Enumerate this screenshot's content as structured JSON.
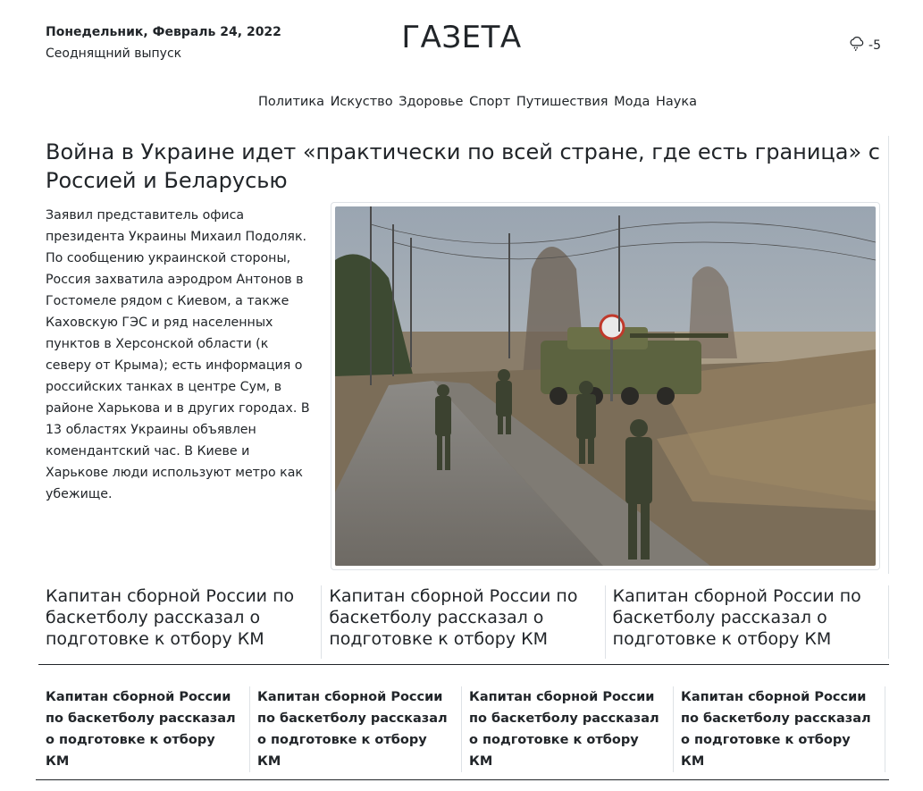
{
  "header": {
    "date": "Понедельник, Февраль 24, 2022",
    "issue": "Сеоднящний выпуск",
    "title": "ГАЗЕТА",
    "weather_value": "-5",
    "weather_icon": "cloud-drizzle-icon"
  },
  "nav": {
    "items": [
      "Политика",
      "Искуство",
      "Здоровье",
      "Спорт",
      "Путишествия",
      "Мода",
      "Наука"
    ]
  },
  "main": {
    "headline": "Война в Украине идет «практически по всей стране, где есть граница» с Россией и Беларусью",
    "lead": "Заявил представитель офиса президента Украины Михаил Подоляк. По сообщению украинской стороны, Россия захватила аэродром Антонов в Гостомеле рядом с Киевом, а также Каховскую ГЭС и ряд населенных пунктов в Херсонской области (к северу от Крыма); есть информация о российских танках в центре Сум, в районе Харькова и в других городах. В 13 областях Украины объявлен комендантский час. В Киеве и Харькове люди используют метро как убежище.",
    "photo_subject": "soldiers-on-road-photo"
  },
  "secondary": [
    {
      "title": "Капитан сборной России по баскетболу рассказал о подготовке к отбору КМ"
    },
    {
      "title": "Капитан сборной России по баскетболу рассказал о подготовке к отбору КМ"
    },
    {
      "title": "Капитан сборной России по баскетболу рассказал о подготовке к отбору КМ"
    }
  ],
  "tertiary": [
    {
      "title": "Капитан сборной России по баскетболу рассказал о подготовке к отбору КМ"
    },
    {
      "title": "Капитан сборной России по баскетболу рассказал о подготовке к отбору КМ"
    },
    {
      "title": "Капитан сборной России по баскетболу рассказал о подготовке к отбору КМ"
    },
    {
      "title": "Капитан сборной России по баскетболу рассказал о подготовке к отбору КМ"
    }
  ]
}
